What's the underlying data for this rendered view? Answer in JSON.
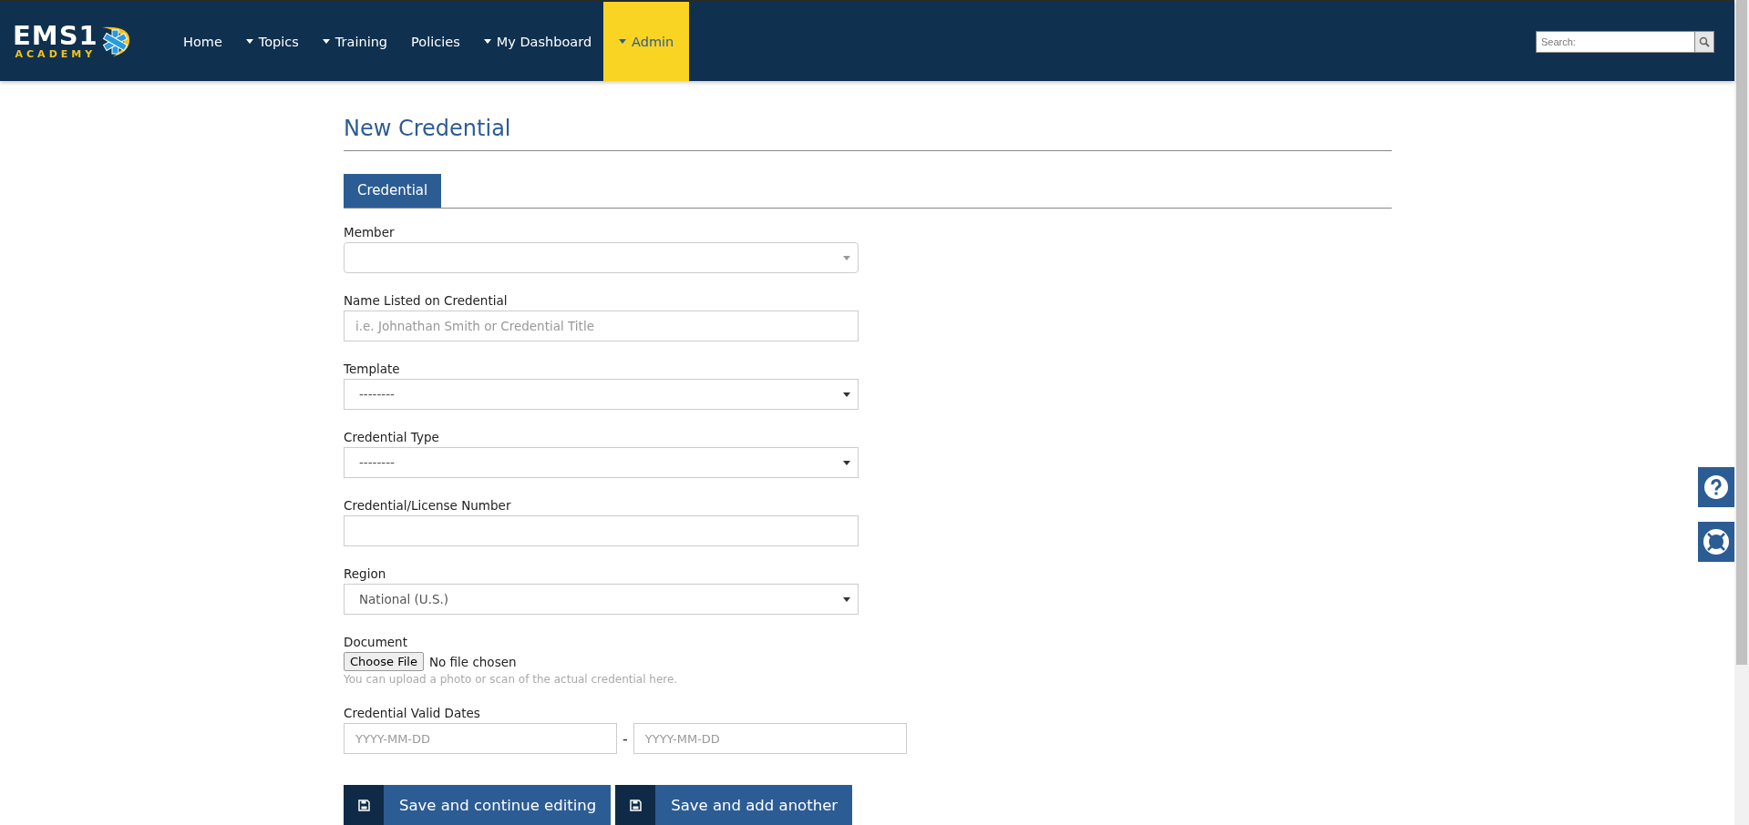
{
  "logo": {
    "title": "EMS1",
    "subtitle": "ACADEMY"
  },
  "nav": [
    {
      "label": "Home",
      "kind": "link",
      "selected": false
    },
    {
      "label": "Topics",
      "kind": "dropdown",
      "selected": false
    },
    {
      "label": "Training",
      "kind": "dropdown",
      "selected": false
    },
    {
      "label": "Policies",
      "kind": "link",
      "selected": false
    },
    {
      "label": "My Dashboard",
      "kind": "dropdown",
      "selected": false
    },
    {
      "label": "Admin",
      "kind": "dropdown",
      "selected": true
    }
  ],
  "search": {
    "placeholder": "Search:"
  },
  "page_title": "New Credential",
  "tabs": [
    {
      "label": "Credential",
      "selected": true
    }
  ],
  "fields": [
    {
      "label": "Member",
      "kind": "combo"
    },
    {
      "label": "Name Listed on Credential",
      "kind": "text",
      "placeholder": "i.e. Johnathan Smith or Credential Title"
    },
    {
      "label": "Template",
      "kind": "select",
      "value": "--------"
    },
    {
      "label": "Credential Type",
      "kind": "select",
      "value": "--------"
    },
    {
      "label": "Credential/License Number",
      "kind": "text"
    },
    {
      "label": "Region",
      "kind": "select",
      "value": "National (U.S.)"
    },
    {
      "label": "Document",
      "kind": "file",
      "button": "Choose File",
      "status": "No file chosen",
      "help": "You can upload a photo or scan of the actual credential here."
    },
    {
      "label": "Credential Valid Dates",
      "kind": "daterange",
      "placeholder_start": "YYYY-MM-DD",
      "separator": "-",
      "placeholder_end": "YYYY-MM-DD"
    }
  ],
  "buttons": [
    "Save and continue editing",
    "Save and add another"
  ]
}
